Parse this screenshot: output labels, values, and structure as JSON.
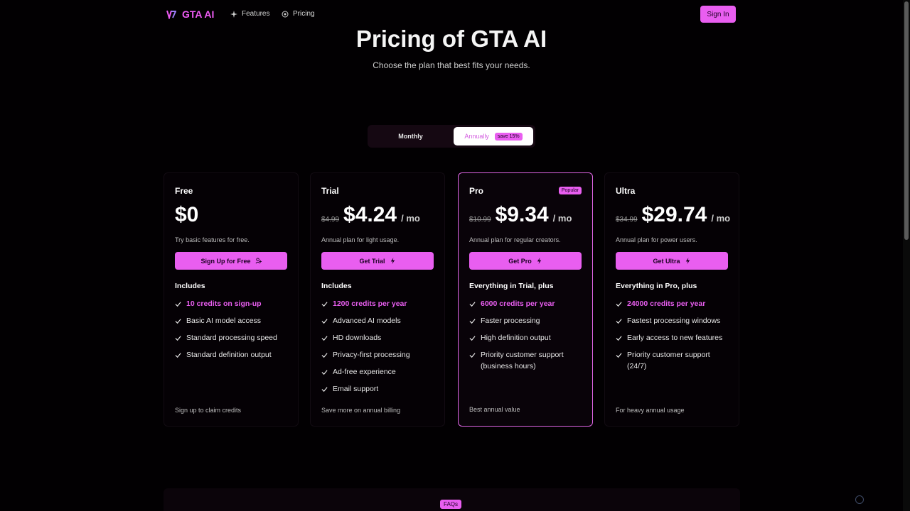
{
  "nav": {
    "brand": "GTA AI",
    "features_label": "Features",
    "pricing_label": "Pricing",
    "signin_label": "Sign In",
    "brand_color": "#ef5cf5"
  },
  "hero": {
    "title": "Pricing of GTA AI",
    "subtitle": "Choose the plan that best fits your needs."
  },
  "billing_toggle": {
    "monthly_label": "Monthly",
    "annually_label": "Annually",
    "save_badge": "save 15%",
    "selected": "Annually"
  },
  "plans": [
    {
      "name": "Free",
      "old_price": "",
      "price": "$0",
      "per": "",
      "description": "Try basic features for free.",
      "cta": "Sign Up for Free",
      "cta_icon": "user-plus-icon",
      "includes_title": "Includes",
      "features": [
        "10 credits on sign-up",
        "Basic AI model access",
        "Standard processing speed",
        "Standard definition output"
      ],
      "footer": "Sign up to claim credits"
    },
    {
      "name": "Trial",
      "old_price": "$4.99",
      "price": "$4.24",
      "per": "/ mo",
      "description": "Annual plan for light usage.",
      "cta": "Get Trial",
      "cta_icon": "lightning-icon",
      "includes_title": "Includes",
      "features": [
        "1200 credits per year",
        "Advanced AI models",
        "HD downloads",
        "Privacy-first processing",
        "Ad-free experience",
        "Email support"
      ],
      "footer": "Save more on annual billing"
    },
    {
      "name": "Pro",
      "badge": "Popular",
      "old_price": "$10.99",
      "price": "$9.34",
      "per": "/ mo",
      "description": "Annual plan for regular creators.",
      "cta": "Get Pro",
      "cta_icon": "lightning-icon",
      "includes_title": "Everything in Trial, plus",
      "features": [
        "6000 credits per year",
        "Faster processing",
        "High definition output",
        "Priority customer support (business hours)"
      ],
      "footer": "Best annual value"
    },
    {
      "name": "Ultra",
      "old_price": "$34.99",
      "price": "$29.74",
      "per": "/ mo",
      "description": "Annual plan for power users.",
      "cta": "Get Ultra",
      "cta_icon": "lightning-icon",
      "includes_title": "Everything in Pro, plus",
      "features": [
        "24000 credits per year",
        "Fastest processing windows",
        "Early access to new features",
        "Priority customer support (24/7)"
      ],
      "footer": "For heavy annual usage"
    }
  ],
  "faq": {
    "badge": "FAQs"
  },
  "accent_color": "#e95ef0"
}
